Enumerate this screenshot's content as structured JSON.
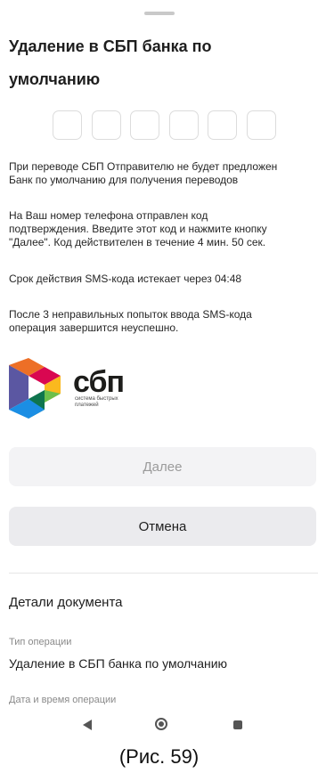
{
  "sheet": {
    "title": "Удаление в СБП банка по умолчанию",
    "title_line1": "Удаление в СБП банка по",
    "title_line2": "умолчанию",
    "code_cells": [
      "",
      "",
      "",
      "",
      "",
      ""
    ]
  },
  "info": {
    "p1_line1": "При переводе СБП Отправителю не будет предложен",
    "p1_line2": "Банк по умолчанию для получения переводов",
    "p2_line1": "На Ваш номер телефона отправлен код",
    "p2_line2": "подтверждения. Введите этот код и нажмите кнопку",
    "p2_line3": "\"Далее\". Код действителен в течение 4 мин. 50 сек.",
    "p3": "Срок действия SMS-кода истекает через 04:48",
    "p4_line1": "После 3 неправильных попыток ввода SMS-кода",
    "p4_line2": "операция завершится неуспешно."
  },
  "logo": {
    "text": "сбп",
    "sub_line1": "система быстрых",
    "sub_line2": "платежей"
  },
  "buttons": {
    "next_label": "Далее",
    "cancel_label": "Отмена"
  },
  "details": {
    "title": "Детали документа",
    "op_type_label": "Тип операции",
    "op_type_value": "Удаление в СБП банка по умолчанию",
    "datetime_label": "Дата и время операции"
  },
  "caption": "(Рис. 59)",
  "colors": {
    "button_bg": "#ebebee",
    "disabled_text": "#9b9b9b"
  }
}
